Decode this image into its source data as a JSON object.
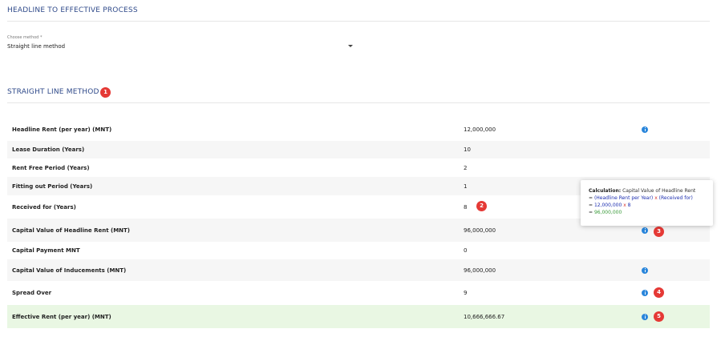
{
  "page": {
    "title": "HEADLINE TO EFFECTIVE PROCESS"
  },
  "method": {
    "label": "Choose method *",
    "value": "Straight line method"
  },
  "section": {
    "title": "STRAIGHT LINE METHOD"
  },
  "badges": [
    "1",
    "2",
    "3",
    "4",
    "5"
  ],
  "rows": [
    {
      "label": "Headline Rent (per year) (MNT)",
      "value": "12,000,000"
    },
    {
      "label": "Lease Duration (Years)",
      "value": "10"
    },
    {
      "label": "Rent Free Period (Years)",
      "value": "2"
    },
    {
      "label": "Fitting out Period (Years)",
      "value": "1"
    },
    {
      "label": "Received for (Years)",
      "value": "8"
    },
    {
      "label": "Capital Value of Headline Rent (MNT)",
      "value": "96,000,000"
    },
    {
      "label": "Capital Payment MNT",
      "value": "0"
    },
    {
      "label": "Capital Value of Inducements (MNT)",
      "value": "96,000,000"
    },
    {
      "label": "Spread Over",
      "value": "9"
    },
    {
      "label": "Effective Rent (per year) (MNT)",
      "value": "10,666,666.67"
    }
  ],
  "tooltip": {
    "title": "Calculation:",
    "title_rest": " Capital Value of Headline Rent",
    "line2_eq": "= ",
    "line2_a": "(Headline Rent per Year)",
    "line2_x": " x ",
    "line2_b": "(Received for)",
    "line3_eq": "= ",
    "line3_a": "12,000,000",
    "line3_x": " x ",
    "line3_b": "8",
    "line4_eq": "= ",
    "line4_val": "96,000,000"
  },
  "icons": {
    "info": "info-icon",
    "dropdown": "chevron-down-icon"
  },
  "colors": {
    "accent": "#2f4a8a",
    "badge": "#e53935",
    "info": "#2a86db",
    "highlight_row": "#e9f7e3"
  }
}
